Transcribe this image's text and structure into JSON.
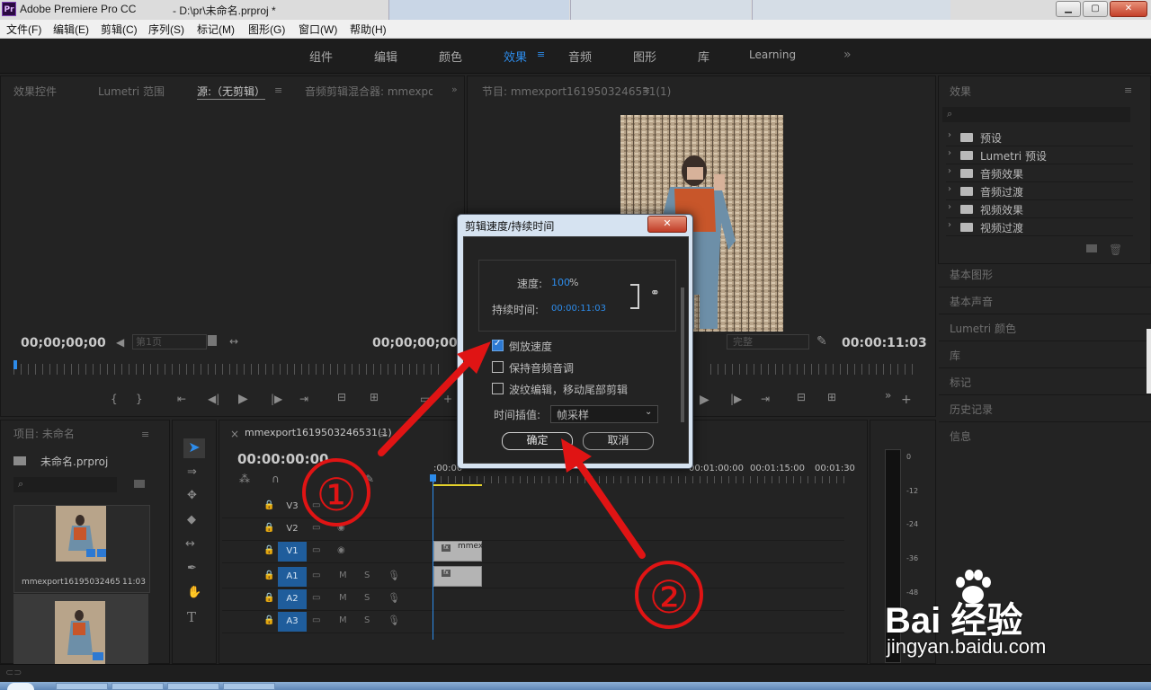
{
  "window": {
    "app_title": "Adobe Premiere Pro CC",
    "project_title": "- D:\\pr\\未命名.prproj *",
    "logo_text": "Pr",
    "min_label": "▁",
    "max_label": "▢",
    "close_label": "✕"
  },
  "menubar": [
    "文件(F)",
    "编辑(E)",
    "剪辑(C)",
    "序列(S)",
    "标记(M)",
    "图形(G)",
    "窗口(W)",
    "帮助(H)"
  ],
  "workspaces": [
    "组件",
    "编辑",
    "颜色",
    "效果",
    "音频",
    "图形",
    "库",
    "Learning"
  ],
  "workspace_more": "»",
  "source_panel": {
    "tabs": [
      "效果控件",
      "Lumetri 范围",
      "源:（无剪辑）",
      "音频剪辑混合器: mmexpo"
    ],
    "timecode_left": "00;00;00;00",
    "page_select": "第1页",
    "timecode_right": "00;00;00;00"
  },
  "program_panel": {
    "title": "节目: mmexport1619503246531(1)",
    "fit_select": "完整",
    "timecode": "00:00:11:03"
  },
  "effects_panel": {
    "title": "效果",
    "items": [
      "预设",
      "Lumetri 预设",
      "音频效果",
      "音频过渡",
      "视频效果",
      "视频过渡"
    ],
    "sections": [
      "基本图形",
      "基本声音",
      "Lumetri 颜色",
      "库",
      "标记",
      "历史记录",
      "信息"
    ]
  },
  "project_panel": {
    "title": "项目: 未命名",
    "file": "未命名.prproj",
    "clip_name": "mmexport1619503246531...",
    "clip_duration": "11:03"
  },
  "timeline": {
    "tab": "mmexport1619503246531(1)",
    "timecode": "00:00:00:00",
    "ruler": [
      ":00:00",
      "00:01:00:00",
      "00:01:15:00",
      "00:01:30"
    ],
    "video_tracks": [
      "V3",
      "V2",
      "V1"
    ],
    "audio_tracks": [
      "A1",
      "A2",
      "A3"
    ],
    "clip_label": "mmex",
    "m_label": "M",
    "s_label": "S"
  },
  "meter_labels": [
    "0",
    "-12",
    "-24",
    "-36",
    "-48"
  ],
  "dialog": {
    "title": "剪辑速度/持续时间",
    "speed_label": "速度:",
    "speed_value": "100",
    "speed_unit": "%",
    "duration_label": "持续时间:",
    "duration_value": "00:00:11:03",
    "reverse_label": "倒放速度",
    "reverse_checked": true,
    "keep_pitch_label": "保持音频音调",
    "ripple_label": "波纹编辑，移动尾部剪辑",
    "interp_label": "时间插值:",
    "interp_value": "帧采样",
    "ok_label": "确定",
    "cancel_label": "取消"
  },
  "annotations": [
    "①",
    "②"
  ],
  "watermark": {
    "brand": "Bai  经验",
    "url": "jingyan.baidu.com"
  },
  "colors": {
    "accent": "#2d8ceb",
    "annotation": "#e01414",
    "track_selected": "#1f5d9c"
  }
}
